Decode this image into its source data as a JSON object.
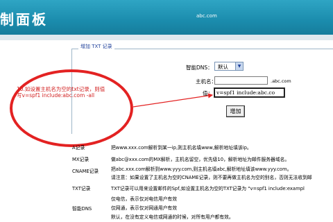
{
  "header": {
    "title": "制面板",
    "domain": "abc.com"
  },
  "form": {
    "legend": "增加 TXT 记录",
    "type_label": "智能DNS：",
    "type_value": "默认",
    "host_label": "主机名：",
    "host_value": "",
    "host_suffix": ".abc.com",
    "value_label": "值：",
    "value_value": "v=spf1 include:abc.co",
    "add_label": "增加"
  },
  "annotation": {
    "line1": "10.如设置主机名为空的txt记录，则值",
    "line2": "写v=spf1 include:abc.com -all"
  },
  "help": {
    "a_key": "A记录",
    "a_text": "把www.xxx.com解析到某一ip,则主机名填www,解析地址填该ip。",
    "mx_key": "MX记录",
    "mx_text": "做abc@xxx.com的MX解析，主机名留空，优先级10，解析地址为邮件服务器域名。",
    "cname_key": "CNAME记录",
    "cname_text1": "把abc.xxx.com解析到www.yyy.com,则主机名填abc,解析地址填该www.yyy.com。",
    "cname_text2": "请注意：如果设置了主机名为空的CNAME记录，则不要再做主机名为空的别名，否则无法收到邮",
    "txt_key": "TXT记录",
    "txt_text": "TXT记录可以用来设置邮件的Spf,如设置主机名为空的TXT记录为 \"v=spf1 include:exampl",
    "dns_key": "智能DNS",
    "dns_text1": "仅电信，表示仅对电信用户有效",
    "dns_text2": "仅网通，表示仅对网通用户有效",
    "dns_text3": "默认，在没有定义电信或网通的时候，对所有用户都有效。"
  },
  "colors": {
    "header": "#1b8cad",
    "annotation": "#e32222",
    "legend": "#1e3f9a"
  }
}
